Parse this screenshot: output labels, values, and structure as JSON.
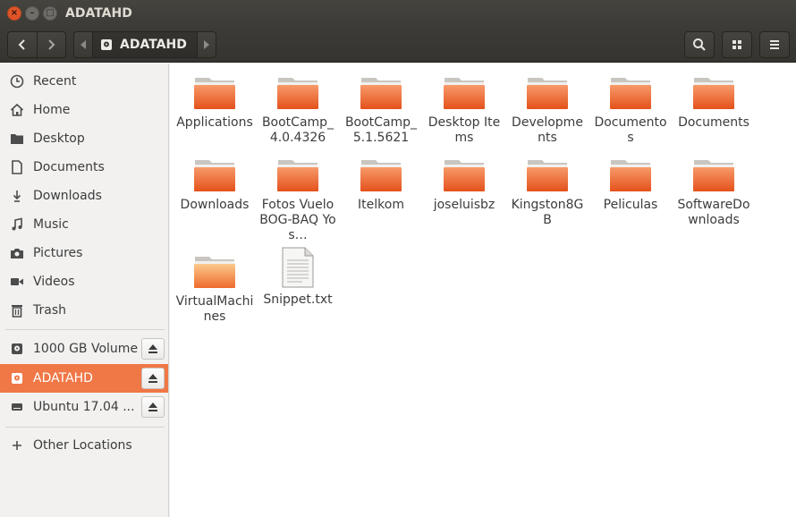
{
  "window": {
    "title": "ADATAHD"
  },
  "titlebar_buttons": {
    "close": "×",
    "minimize": "–",
    "maximize": "□"
  },
  "toolbar": {
    "path_crumb": "ADATAHD"
  },
  "sidebar": {
    "places": [
      {
        "label": "Recent",
        "icon": "clock-icon"
      },
      {
        "label": "Home",
        "icon": "home-icon"
      },
      {
        "label": "Desktop",
        "icon": "folder-icon"
      },
      {
        "label": "Documents",
        "icon": "document-icon"
      },
      {
        "label": "Downloads",
        "icon": "download-icon"
      },
      {
        "label": "Music",
        "icon": "music-icon"
      },
      {
        "label": "Pictures",
        "icon": "camera-icon"
      },
      {
        "label": "Videos",
        "icon": "video-icon"
      },
      {
        "label": "Trash",
        "icon": "trash-icon"
      }
    ],
    "devices": [
      {
        "label": "1000 GB Volume",
        "icon": "drive-icon",
        "active": false
      },
      {
        "label": "ADATAHD",
        "icon": "drive-icon",
        "active": true
      },
      {
        "label": "Ubuntu 17.04 ...",
        "icon": "drive-icon",
        "active": false
      }
    ],
    "other_locations": "Other Locations"
  },
  "files": [
    {
      "name": "Applications",
      "type": "folder"
    },
    {
      "name": "BootCamp_4.0.4326",
      "type": "folder"
    },
    {
      "name": "BootCamp_5.1.5621",
      "type": "folder"
    },
    {
      "name": "Desktop Items",
      "type": "folder"
    },
    {
      "name": "Developments",
      "type": "folder"
    },
    {
      "name": "Documentos",
      "type": "folder"
    },
    {
      "name": "Documents",
      "type": "folder"
    },
    {
      "name": "Downloads",
      "type": "folder"
    },
    {
      "name": "Fotos Vuelo BOG-BAQ Yos…",
      "type": "folder"
    },
    {
      "name": "Itelkom",
      "type": "folder"
    },
    {
      "name": "joseluisbz",
      "type": "folder"
    },
    {
      "name": "Kingston8GB",
      "type": "folder"
    },
    {
      "name": "Peliculas",
      "type": "folder"
    },
    {
      "name": "SoftwareDownloads",
      "type": "folder"
    },
    {
      "name": "VirtualMachines",
      "type": "folder"
    },
    {
      "name": "Snippet.txt",
      "type": "text-file"
    }
  ],
  "colors": {
    "accent": "#f07746",
    "folder_top": "#f5a67e",
    "folder_body": "#e95420"
  }
}
